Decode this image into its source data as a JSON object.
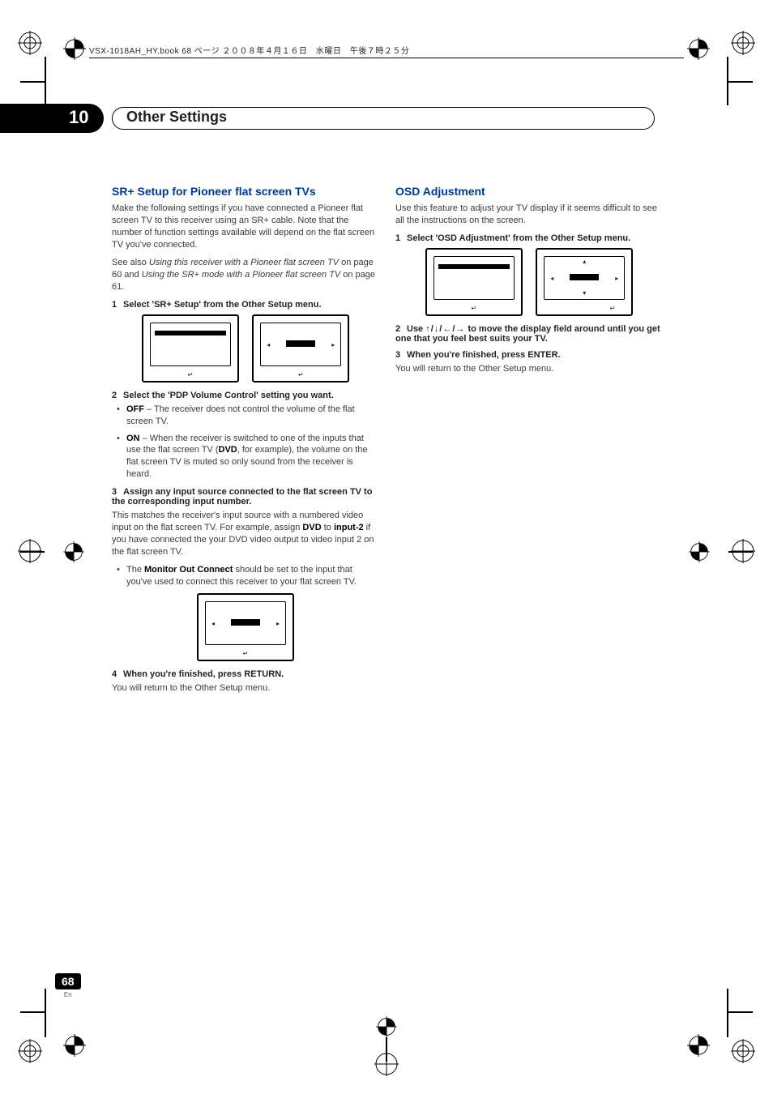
{
  "runhead": "VSX-1018AH_HY.book  68 ページ  ２００８年４月１６日　水曜日　午後７時２５分",
  "chapter": {
    "num": "10",
    "title": "Other Settings"
  },
  "left": {
    "heading": "SR+ Setup for Pioneer flat screen TVs",
    "para1": "Make the following settings if you have connected a Pioneer flat screen TV to this receiver using an SR+ cable. Note that the number of function settings available will depend on the flat screen TV you've connected.",
    "para2a": "See also ",
    "para2i1": "Using this receiver with a Pioneer flat screen TV",
    "para2b": " on page 60 and ",
    "para2i2": "Using the SR+ mode with a Pioneer flat screen TV",
    "para2c": " on page 61.",
    "step1": "Select 'SR+ Setup' from the Other Setup menu.",
    "step2": "Select the 'PDP Volume Control' setting you want.",
    "bullet_off_b": "OFF",
    "bullet_off": " – The receiver does not control the volume of the flat screen TV.",
    "bullet_on_b": "ON",
    "bullet_on": " – When the receiver is switched to one of the inputs that use the flat screen TV (",
    "bullet_on_dvd": "DVD",
    "bullet_on2": ", for example), the volume on the flat screen TV is muted so only sound from the receiver is heard.",
    "step3": "Assign any input source connected to the flat screen TV to the corresponding input number.",
    "para3a": "This matches the receiver's input source with a numbered video input on the flat screen TV. For example, assign ",
    "para3b_dvd": "DVD",
    "para3c": " to ",
    "para3d_in": "input-2",
    "para3e": " if you have connected the your DVD video output to video input 2 on the flat screen TV.",
    "bullet_mon1": "The ",
    "bullet_mon_b": "Monitor Out Connect",
    "bullet_mon2": " should be set to the input that you've used to connect this receiver to your flat screen TV.",
    "step4": "When you're finished, press RETURN.",
    "para4": "You will return to the Other Setup menu."
  },
  "right": {
    "heading": "OSD Adjustment",
    "para1": "Use this feature to adjust your TV display if it seems difficult to see all the instructions on the screen.",
    "step1": "Select 'OSD Adjustment' from the Other Setup menu.",
    "step2a": "Use ",
    "step2b": " to move the display field around until you get one that you feel best suits your TV.",
    "arrows": "↑/↓/←/→",
    "step3": "When you're finished, press ENTER.",
    "para3": "You will return to the Other Setup menu."
  },
  "step_nums": {
    "n1": "1",
    "n2": "2",
    "n3": "3",
    "n4": "4"
  },
  "page": {
    "num": "68",
    "lang": "En"
  },
  "glyphs": {
    "return": "↵",
    "tri_l": "◂",
    "tri_r": "▸",
    "tri_u": "▴",
    "tri_d": "▾"
  }
}
